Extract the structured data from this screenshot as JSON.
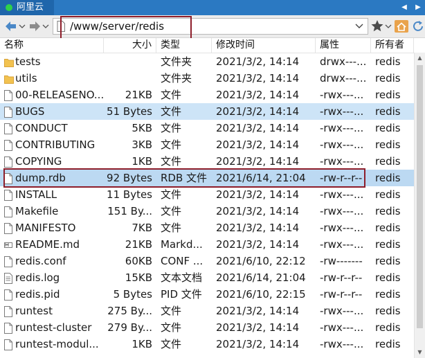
{
  "tab": {
    "title": "阿里云"
  },
  "address": {
    "path": "/www/server/redis"
  },
  "columns": {
    "name": "名称",
    "size": "大小",
    "type": "类型",
    "modified": "修改时间",
    "attributes": "属性",
    "owner": "所有者"
  },
  "files": [
    {
      "name": "tests",
      "size": "",
      "type": "文件夹",
      "modified": "2021/3/2, 14:14",
      "attributes": "drwx---...",
      "owner": "redis",
      "icon": "folder-icon"
    },
    {
      "name": "utils",
      "size": "",
      "type": "文件夹",
      "modified": "2021/3/2, 14:14",
      "attributes": "drwx---...",
      "owner": "redis",
      "icon": "folder-icon"
    },
    {
      "name": "00-RELEASENO...",
      "size": "21KB",
      "type": "文件",
      "modified": "2021/3/2, 14:14",
      "attributes": "-rwx---...",
      "owner": "redis",
      "icon": "file-icon"
    },
    {
      "name": "BUGS",
      "size": "51 Bytes",
      "type": "文件",
      "modified": "2021/3/2, 14:14",
      "attributes": "-rwx---...",
      "owner": "redis",
      "icon": "file-icon"
    },
    {
      "name": "CONDUCT",
      "size": "5KB",
      "type": "文件",
      "modified": "2021/3/2, 14:14",
      "attributes": "-rwx---...",
      "owner": "redis",
      "icon": "file-icon"
    },
    {
      "name": "CONTRIBUTING",
      "size": "3KB",
      "type": "文件",
      "modified": "2021/3/2, 14:14",
      "attributes": "-rwx---...",
      "owner": "redis",
      "icon": "file-icon"
    },
    {
      "name": "COPYING",
      "size": "1KB",
      "type": "文件",
      "modified": "2021/3/2, 14:14",
      "attributes": "-rwx---...",
      "owner": "redis",
      "icon": "file-icon"
    },
    {
      "name": "dump.rdb",
      "size": "92 Bytes",
      "type": "RDB 文件",
      "modified": "2021/6/14, 21:04",
      "attributes": "-rw-r--r--",
      "owner": "redis",
      "icon": "file-icon"
    },
    {
      "name": "INSTALL",
      "size": "11 Bytes",
      "type": "文件",
      "modified": "2021/3/2, 14:14",
      "attributes": "-rwx---...",
      "owner": "redis",
      "icon": "file-icon"
    },
    {
      "name": "Makefile",
      "size": "151 By...",
      "type": "文件",
      "modified": "2021/3/2, 14:14",
      "attributes": "-rwx---...",
      "owner": "redis",
      "icon": "file-icon"
    },
    {
      "name": "MANIFESTO",
      "size": "7KB",
      "type": "文件",
      "modified": "2021/3/2, 14:14",
      "attributes": "-rwx---...",
      "owner": "redis",
      "icon": "file-icon"
    },
    {
      "name": "README.md",
      "size": "21KB",
      "type": "Markd...",
      "modified": "2021/3/2, 14:14",
      "attributes": "-rwx---...",
      "owner": "redis",
      "icon": "markdown-file-icon"
    },
    {
      "name": "redis.conf",
      "size": "60KB",
      "type": "CONF ...",
      "modified": "2021/6/10, 22:12",
      "attributes": "-rw-------",
      "owner": "redis",
      "icon": "file-icon"
    },
    {
      "name": "redis.log",
      "size": "15KB",
      "type": "文本文档",
      "modified": "2021/6/14, 21:04",
      "attributes": "-rw-r--r--",
      "owner": "redis",
      "icon": "text-file-icon"
    },
    {
      "name": "redis.pid",
      "size": "5 Bytes",
      "type": "PID 文件",
      "modified": "2021/6/10, 22:15",
      "attributes": "-rw-r--r--",
      "owner": "redis",
      "icon": "file-icon"
    },
    {
      "name": "runtest",
      "size": "275 By...",
      "type": "文件",
      "modified": "2021/3/2, 14:14",
      "attributes": "-rwx---...",
      "owner": "redis",
      "icon": "file-icon"
    },
    {
      "name": "runtest-cluster",
      "size": "279 By...",
      "type": "文件",
      "modified": "2021/3/2, 14:14",
      "attributes": "-rwx---...",
      "owner": "redis",
      "icon": "file-icon"
    },
    {
      "name": "runtest-modul...",
      "size": "1KB",
      "type": "文件",
      "modified": "2021/3/2, 14:14",
      "attributes": "-rwx---...",
      "owner": "redis",
      "icon": "file-icon"
    }
  ],
  "selection": {
    "hovered_index": 3,
    "selected_index": 7
  },
  "colors": {
    "tabbar": "#2b79c2",
    "selected_row": "#bcd9f2",
    "hover_row": "#cde4f7",
    "annotation": "#8d1d2a",
    "folder": "#f2c250"
  }
}
